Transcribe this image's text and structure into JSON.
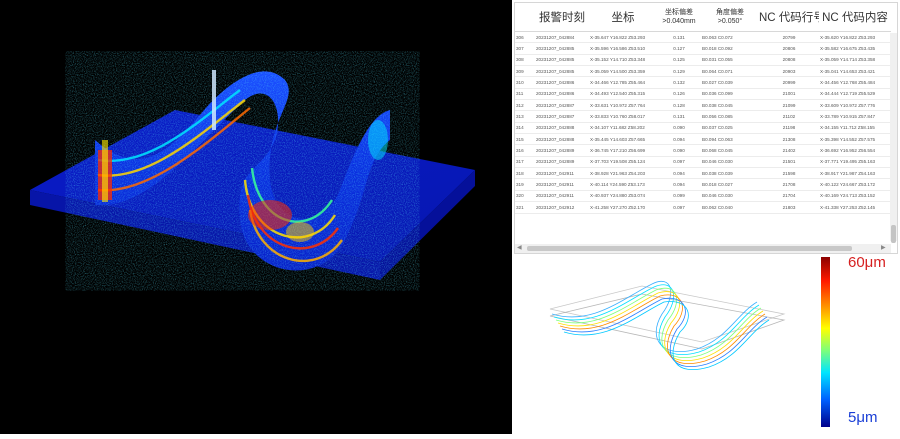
{
  "table": {
    "headers": [
      {
        "lines": [
          ""
        ]
      },
      {
        "lines": [
          "报警时刻"
        ]
      },
      {
        "lines": [
          "坐标"
        ]
      },
      {
        "lines": [
          "坐标偏差",
          ">0.040mm"
        ]
      },
      {
        "lines": [
          "角度偏差",
          ">0.050°"
        ]
      },
      {
        "lines": [
          "NC 代码行号"
        ]
      },
      {
        "lines": [
          "NC 代码内容"
        ]
      }
    ],
    "rows": [
      [
        "306",
        "20231207_042884",
        "X-35.647 Y16.822 Z53.293",
        "0.131",
        "B0.063 C0.072",
        "20799",
        "X-35.620 Y16.822 Z53.293"
      ],
      [
        "307",
        "20231207_042885",
        "X-35.596 Y16.586 Z53.510",
        "0.127",
        "B0.018 C0.092",
        "20806",
        "X-35.582 Y16.675 Z53.435"
      ],
      [
        "308",
        "20231207_042885",
        "X-35.152 Y14.710 Z53.348",
        "0.125",
        "B0.031 C0.055",
        "20808",
        "X-35.059 Y14.714 Z53.358"
      ],
      [
        "309",
        "20231207_042885",
        "X-35.059 Y14.500 Z53.359",
        "0.129",
        "B0.064 C0.071",
        "20903",
        "X-35.041 Y14.653 Z53.421"
      ],
      [
        "310",
        "20231207_042886",
        "X-34.466 Y12.785 Z55.464",
        "0.132",
        "B0.027 C0.039",
        "20999",
        "X-34.456 Y12.768 Z55.484"
      ],
      [
        "311",
        "20231207_042886",
        "X-34.493 Y12.540 Z55.315",
        "0.126",
        "B0.036 C0.099",
        "21001",
        "X-34.444 Y12.719 Z55.529"
      ],
      [
        "312",
        "20231207_042887",
        "X-33.631 Y10.972 Z57.764",
        "0.128",
        "B0.038 C0.045",
        "21099",
        "X-33.609 Y10.972 Z57.776"
      ],
      [
        "313",
        "20231207_042887",
        "X-33.833 Y10.760 Z58.017",
        "0.131",
        "B0.056 C0.085",
        "21102",
        "X-33.789 Y10.915 Z57.847"
      ],
      [
        "314",
        "20231207_042888",
        "X-34.107 Y11.682 Z58.202",
        "0.090",
        "B0.037 C0.025",
        "21198",
        "X-34.155 Y11.712 Z58.155"
      ],
      [
        "315",
        "20231207_042888",
        "X-35.445 Y14.603 Z57.665",
        "0.094",
        "B0.094 C0.063",
        "21308",
        "X-35.398 Y14.552 Z57.575"
      ],
      [
        "316",
        "20231207_042889",
        "X-36.745 Y17.210 Z56.699",
        "0.090",
        "B0.068 C0.045",
        "21402",
        "X-36.692 Y16.952 Z56.554"
      ],
      [
        "317",
        "20231207_042889",
        "X-37.703 Y19.508 Z55.124",
        "0.097",
        "B0.046 C0.030",
        "21501",
        "X-37.771 Y19.495 Z55.163"
      ],
      [
        "318",
        "20231207_042911",
        "X-38.928 Y21.963 Z54.203",
        "0.094",
        "B0.038 C0.039",
        "21598",
        "X-38.917 Y21.987 Z54.163"
      ],
      [
        "319",
        "20231207_042911",
        "X-40.114 Y24.590 Z53.173",
        "0.094",
        "B0.018 C0.027",
        "21708",
        "X-40.122 Y24.667 Z53.172"
      ],
      [
        "320",
        "20231207_042911",
        "X-40.937 Y24.880 Z53.074",
        "0.099",
        "B0.046 C0.030",
        "21704",
        "X-40.169 Y24.713 Z53.152"
      ],
      [
        "321",
        "20231207_042912",
        "X-41.258 Y27.270 Z52.170",
        "0.097",
        "B0.062 C0.040",
        "21803",
        "X-41.338 Y27.253 Z52.145"
      ]
    ]
  },
  "colorbar": {
    "max_label": "60μm",
    "min_label": "5μm",
    "max_color": "#d62020",
    "min_color": "#1a3fd6"
  },
  "icons": {
    "scroll_left": "arrow-left-icon",
    "scroll_right": "arrow-right-icon"
  }
}
